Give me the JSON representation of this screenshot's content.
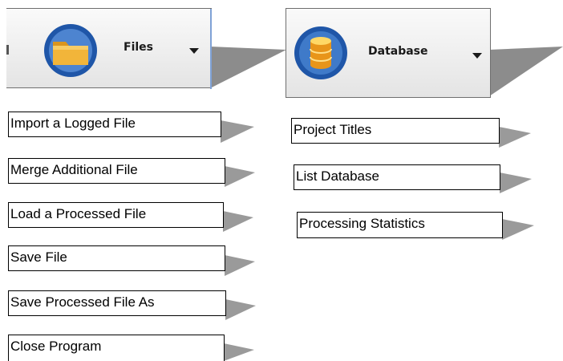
{
  "files": {
    "label": "Files",
    "icon": "folder-icon",
    "items": [
      {
        "label": "Import a Logged File"
      },
      {
        "label": "Merge Additional File"
      },
      {
        "label": "Load a Processed File"
      },
      {
        "label": "Save File"
      },
      {
        "label": "Save Processed File As"
      },
      {
        "label": "Close Program"
      }
    ]
  },
  "database": {
    "label": "Database",
    "icon": "database-icon",
    "items": [
      {
        "label": "Project Titles"
      },
      {
        "label": "List Database"
      },
      {
        "label": "Processing Statistics"
      }
    ]
  },
  "colors": {
    "ring_blue": "#1f56a8",
    "folder_yellow": "#f2b53a",
    "db_gold": "#f0a020",
    "shadow_gray": "#8c8c8c"
  }
}
